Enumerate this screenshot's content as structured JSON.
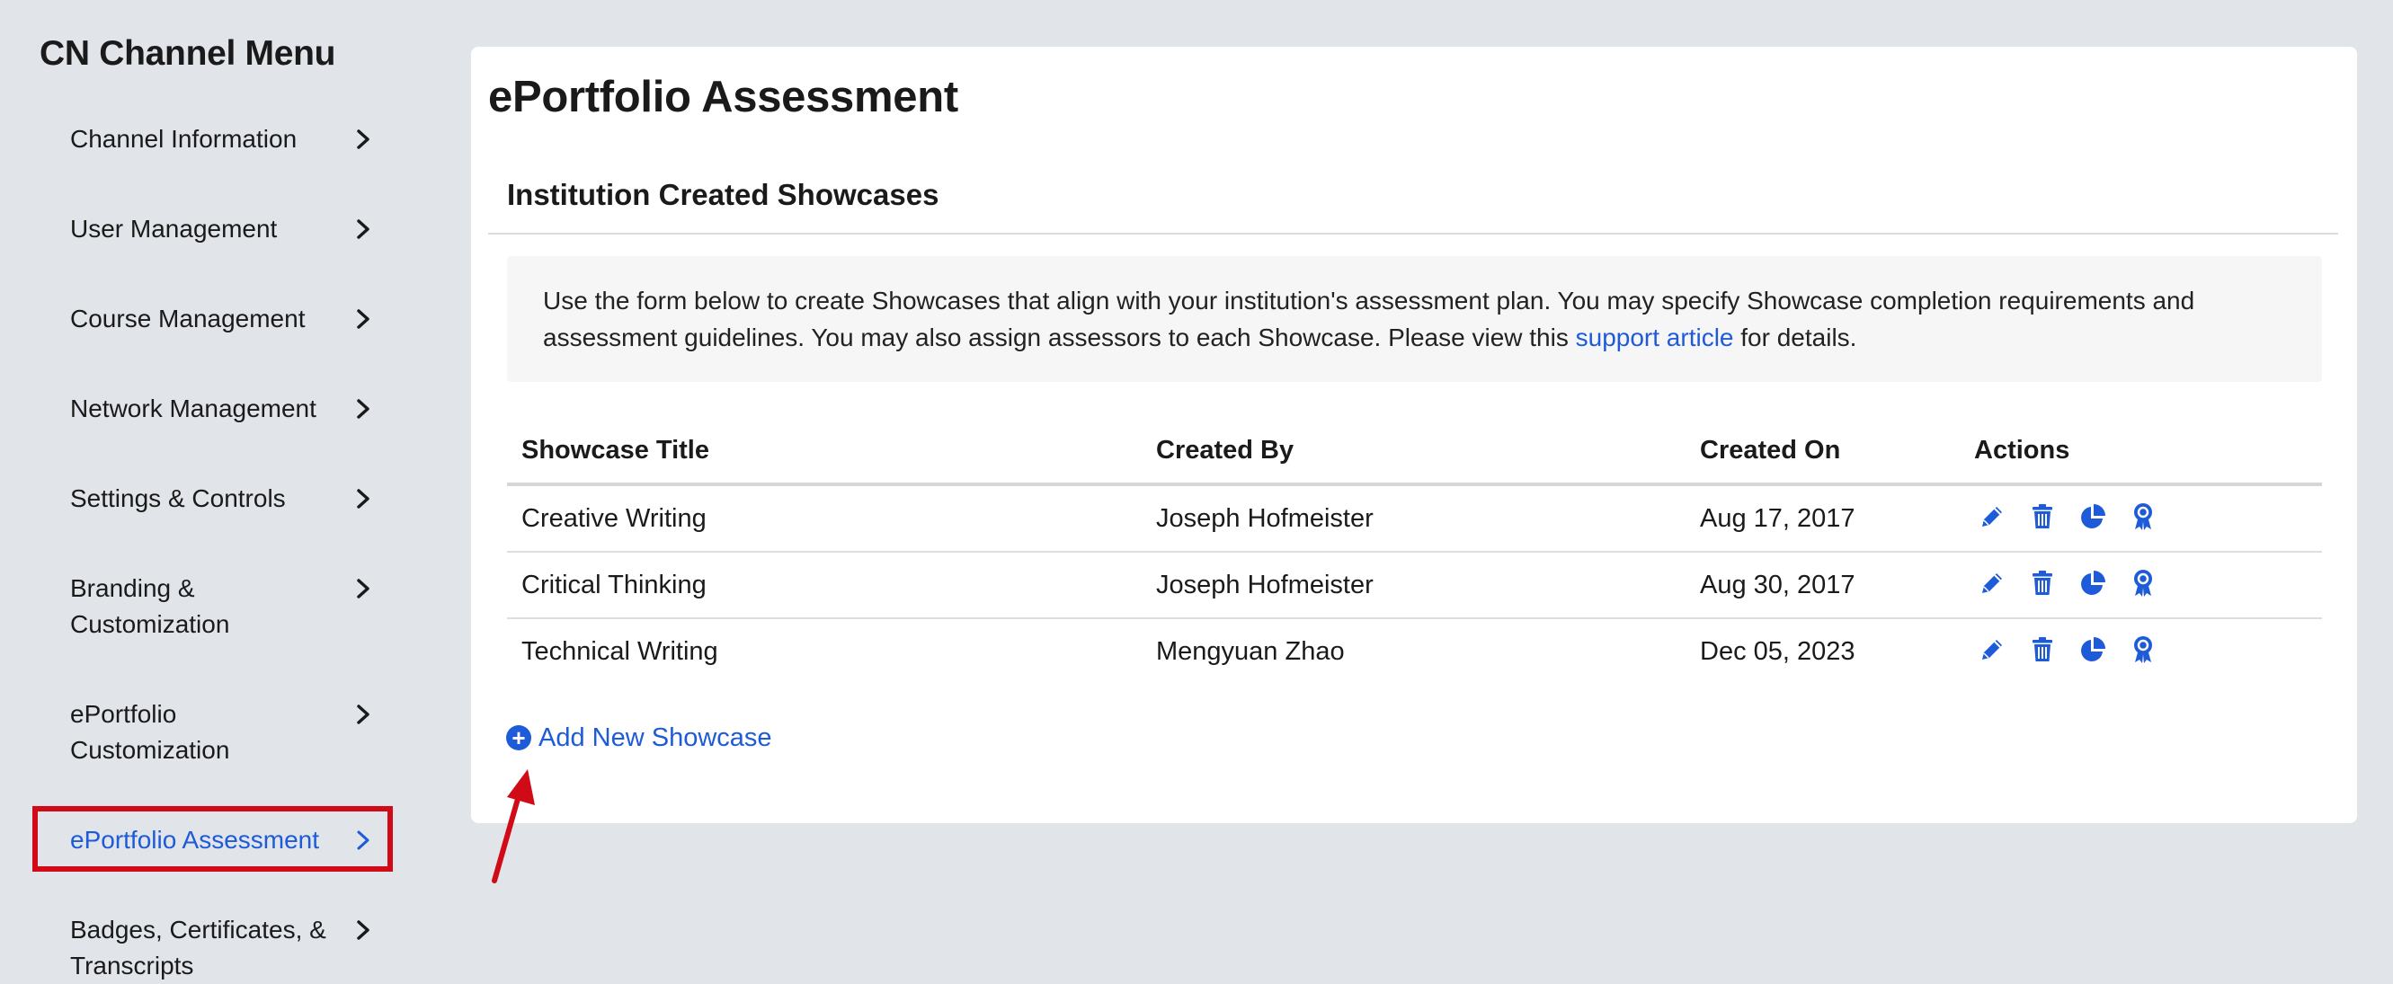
{
  "sidebar": {
    "title": "CN Channel Menu",
    "items": [
      {
        "label": "Channel Information"
      },
      {
        "label": "User Management"
      },
      {
        "label": "Course Management"
      },
      {
        "label": "Network Management"
      },
      {
        "label": "Settings & Controls"
      },
      {
        "label": "Branding & Customization"
      },
      {
        "label": "ePortfolio Customization"
      },
      {
        "label": "ePortfolio Assessment",
        "active": true
      },
      {
        "label": "Badges, Certificates, & Transcripts"
      }
    ]
  },
  "main": {
    "page_title": "ePortfolio Assessment",
    "section_title": "Institution Created Showcases",
    "info": {
      "text_before": "Use the form below to create Showcases that align with your institution's assessment plan. You may specify Showcase completion requirements and assessment guidelines. You may also assign assessors to each Showcase. Please view this ",
      "link_text": "support article",
      "text_after": " for details."
    },
    "table": {
      "headers": [
        "Showcase Title",
        "Created By",
        "Created On",
        "Actions"
      ],
      "rows": [
        {
          "title": "Creative Writing",
          "created_by": "Joseph Hofmeister",
          "created_on": "Aug 17, 2017"
        },
        {
          "title": "Critical Thinking",
          "created_by": "Joseph Hofmeister",
          "created_on": "Aug 30, 2017"
        },
        {
          "title": "Technical Writing",
          "created_by": "Mengyuan Zhao",
          "created_on": "Dec 05, 2023"
        }
      ],
      "action_icons": [
        "edit-icon",
        "trash-icon",
        "pie-chart-icon",
        "badge-icon"
      ]
    },
    "add_button_label": "Add New Showcase"
  },
  "colors": {
    "accent": "#1d5bd8",
    "highlight": "#d10a17",
    "background": "#e1e4e9"
  }
}
